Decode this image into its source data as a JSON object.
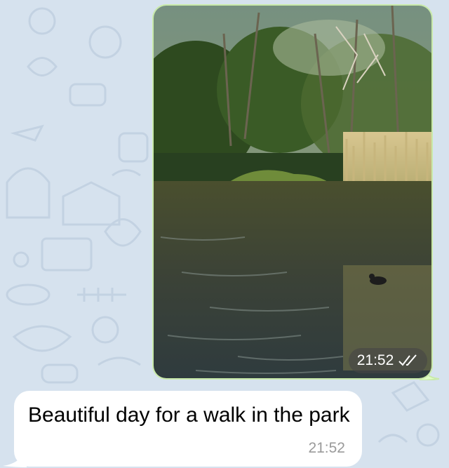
{
  "messages": {
    "outgoing_photo": {
      "time": "21:52",
      "status_icon": "double-check-icon"
    },
    "incoming_text": {
      "text": "Beautiful day for a walk in the park",
      "time": "21:52"
    }
  },
  "colors": {
    "chat_background": "#d6e2ee",
    "outgoing_bubble": "#e1fec6",
    "incoming_bubble": "#ffffff",
    "time_muted": "#9a9a9a"
  }
}
